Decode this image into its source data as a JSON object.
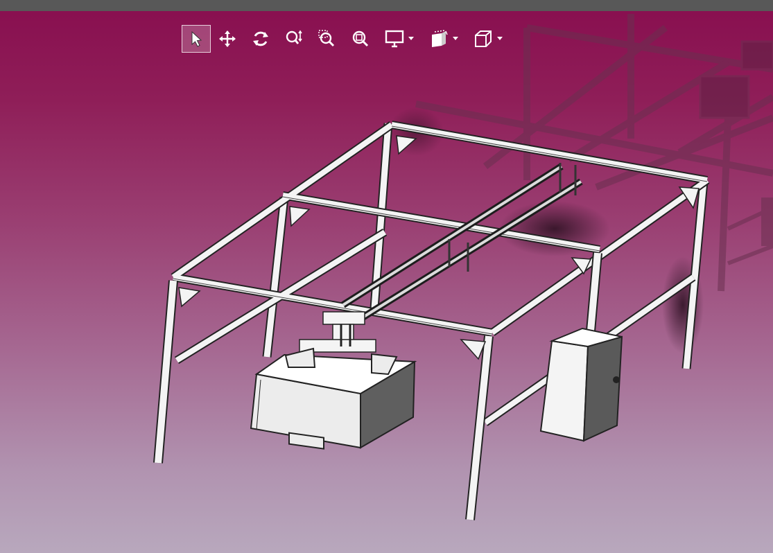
{
  "viewer": {
    "background": {
      "top": "#880e4f",
      "bottom": "#b8a8bd"
    },
    "toolbar": {
      "tools": [
        {
          "name": "select-tool",
          "icon": "cursor-arrow-icon",
          "active": true
        },
        {
          "name": "pan-tool",
          "icon": "four-way-arrows-icon",
          "active": false
        },
        {
          "name": "rotate-tool",
          "icon": "rotate-icon",
          "active": false
        },
        {
          "name": "zoom-tool",
          "icon": "zoom-updown-icon",
          "active": false
        },
        {
          "name": "zoom-window-tool",
          "icon": "zoom-window-icon",
          "active": false
        },
        {
          "name": "zoom-fit-tool",
          "icon": "zoom-fit-icon",
          "active": false
        },
        {
          "name": "display-mode-menu",
          "icon": "monitor-icon",
          "has_dropdown": true
        },
        {
          "name": "view-orientation-menu",
          "icon": "standard-views-icon",
          "has_dropdown": true
        },
        {
          "name": "render-style-menu",
          "icon": "wireframe-cube-icon",
          "has_dropdown": true
        }
      ]
    },
    "model": {
      "objects": [
        "aluminium-frame-gantry",
        "gantry-rail",
        "gripper-head",
        "storage-crate",
        "control-cabinet"
      ],
      "ghost_background": true
    }
  }
}
